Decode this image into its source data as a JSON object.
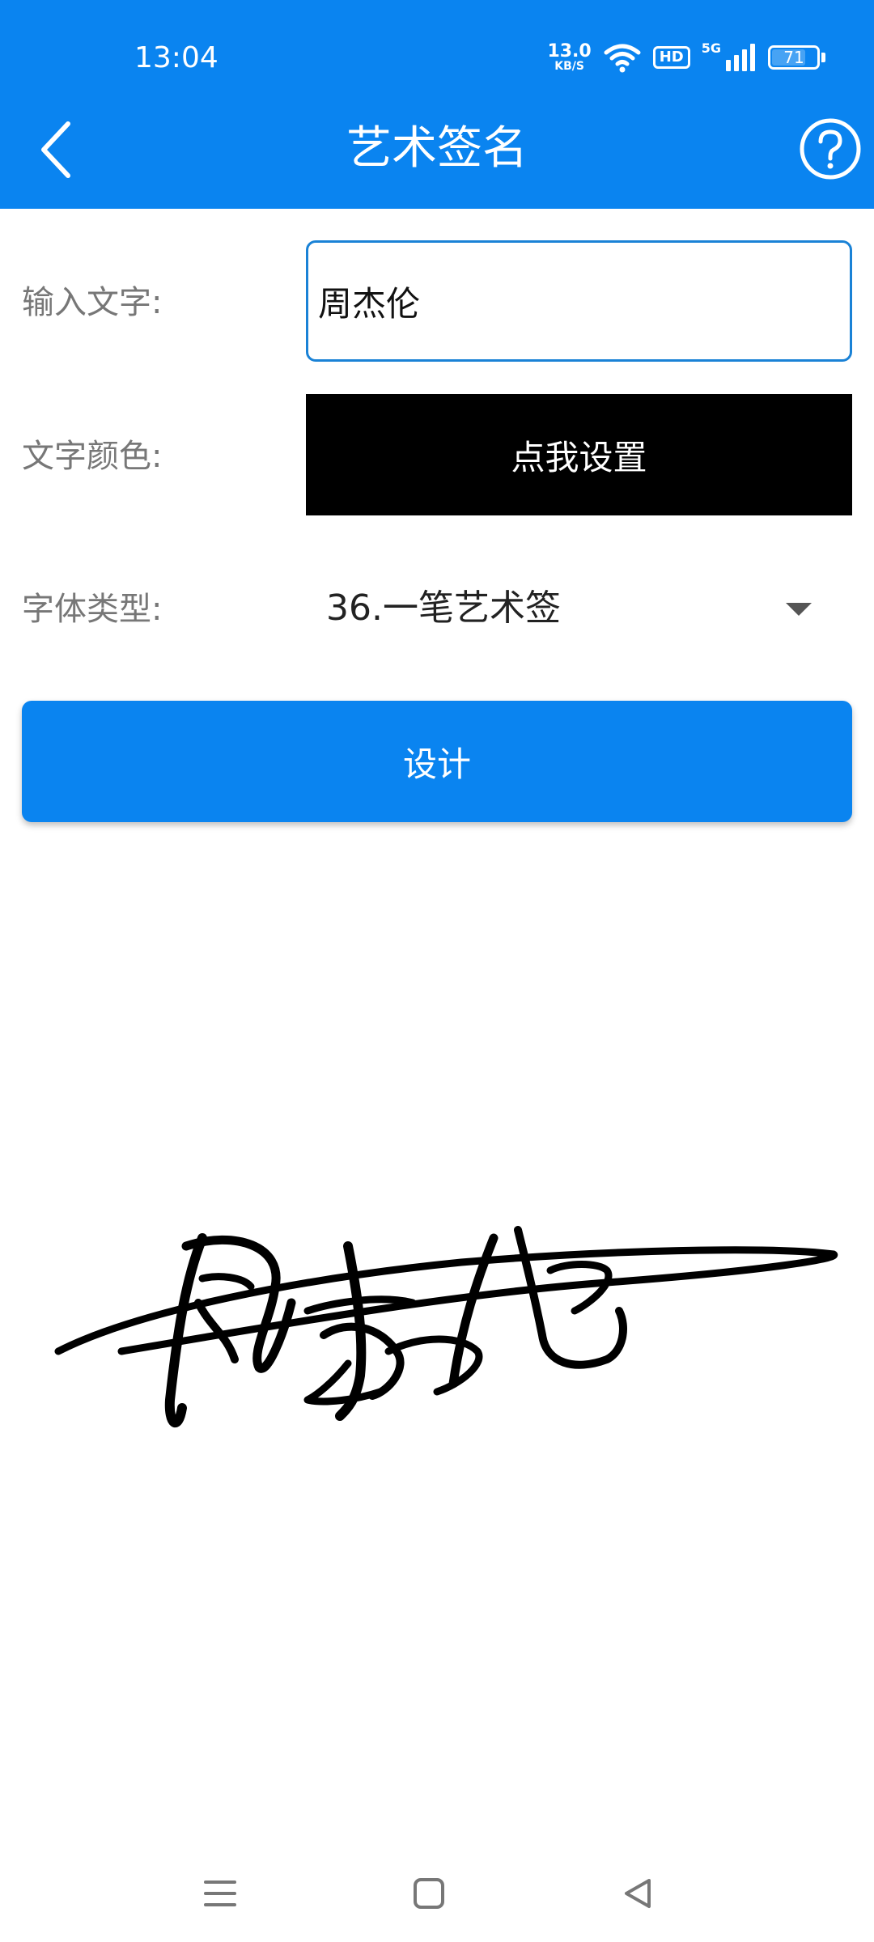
{
  "status_bar": {
    "time": "13:04",
    "network_speed": "13.0",
    "network_speed_unit": "KB/S",
    "hd_badge": "HD",
    "network_type": "5G",
    "battery": "71",
    "battery_level": 0.71
  },
  "header": {
    "title": "艺术签名",
    "back_icon": "chevron-left-icon",
    "help_icon": "question-circle-icon",
    "color": "#0a84f0"
  },
  "form": {
    "input_label": "输入文字:",
    "input_value": "周杰伦",
    "color_label": "文字颜色:",
    "color_button": "点我设置",
    "text_color": "#000000",
    "font_label": "字体类型:",
    "font_value": "36.一笔艺术签"
  },
  "design_button": "设计",
  "signature": {
    "text": "周杰伦"
  },
  "nav_bar": {
    "menu_icon": "menu-icon",
    "home_icon": "square-home-icon",
    "back_icon": "triangle-back-icon"
  }
}
